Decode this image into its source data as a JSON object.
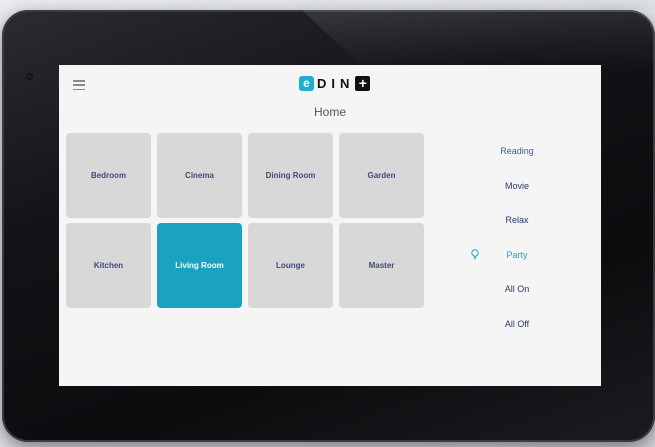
{
  "header": {
    "menu_icon": "hamburger-menu-icon",
    "logo_e": "e",
    "logo_text": "DIN",
    "logo_plus": "+"
  },
  "page": {
    "title": "Home"
  },
  "rooms": [
    {
      "label": "Bedroom",
      "active": false
    },
    {
      "label": "Cinema",
      "active": false
    },
    {
      "label": "Dining Room",
      "active": false
    },
    {
      "label": "Garden",
      "active": false
    },
    {
      "label": "Kitchen",
      "active": false
    },
    {
      "label": "Living Room",
      "active": true
    },
    {
      "label": "Lounge",
      "active": false
    },
    {
      "label": "Master",
      "active": false
    }
  ],
  "scenes": [
    {
      "label": "Reading",
      "active": false
    },
    {
      "label": "Movie",
      "active": false
    },
    {
      "label": "Relax",
      "active": false
    },
    {
      "label": "Party",
      "active": true,
      "icon": "lightbulb-icon"
    },
    {
      "label": "All On",
      "active": false
    },
    {
      "label": "All Off",
      "active": false
    }
  ],
  "colors": {
    "accent": "#1aa3c1",
    "tile": "#d8d8d8",
    "scene_text": "#3f5d96"
  }
}
